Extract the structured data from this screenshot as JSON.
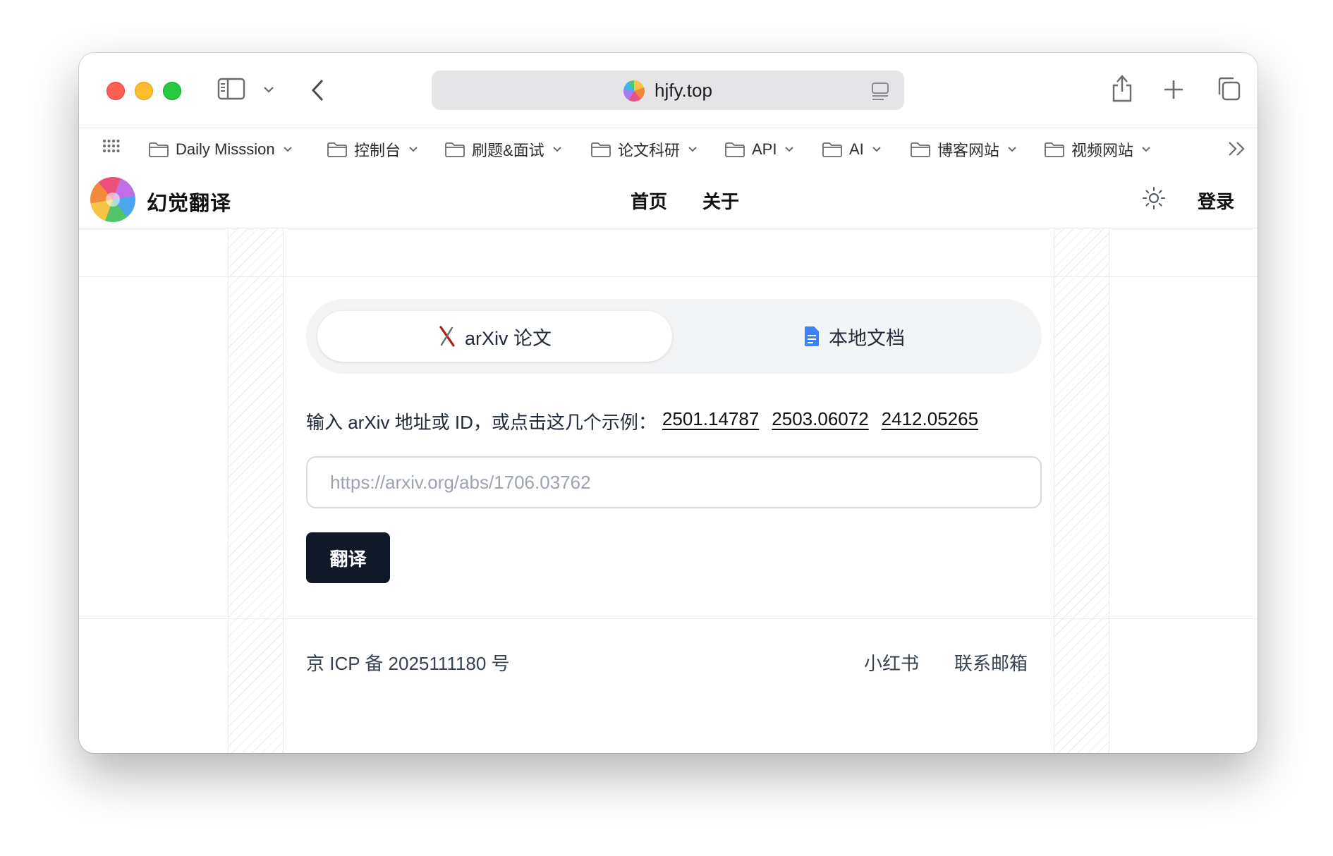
{
  "browser": {
    "url": "hjfy.top",
    "bookmarks": [
      {
        "label": "Daily Misssion"
      },
      {
        "label": "控制台"
      },
      {
        "label": "刷题&面试"
      },
      {
        "label": "论文科研"
      },
      {
        "label": "API"
      },
      {
        "label": "AI"
      },
      {
        "label": "博客网站"
      },
      {
        "label": "视频网站"
      }
    ],
    "icons": [
      "sidebar-toggle-icon",
      "chevron-down-icon",
      "back-arrow-icon",
      "reader-icon",
      "share-icon",
      "plus-icon",
      "tabs-overview-icon",
      "apps-grid-icon",
      "folder-icon",
      "double-chevron-icon"
    ]
  },
  "site": {
    "brand": "幻觉翻译",
    "nav": {
      "home": "首页",
      "about": "关于"
    },
    "login": "登录",
    "theme_icon": "sun-icon"
  },
  "tabs": {
    "arxiv": "arXiv 论文",
    "local": "本地文档"
  },
  "main": {
    "hint_prefix": "输入 arXiv 地址或 ID，或点击这几个示例：",
    "examples": [
      "2501.14787",
      "2503.06072",
      "2412.05265"
    ],
    "input_placeholder": "https://arxiv.org/abs/1706.03762",
    "input_value": "",
    "button_label": "翻译"
  },
  "footer": {
    "icp": "京 ICP 备 2025111180 号",
    "links": [
      "小红书",
      "联系邮箱"
    ]
  },
  "colors": {
    "traffic_red": "#fe5f57",
    "traffic_yellow": "#febc2e",
    "traffic_green": "#28c840",
    "button_bg": "#111827",
    "doc_icon": "#3b82f6",
    "arxiv_icon": "#b31b1b"
  }
}
